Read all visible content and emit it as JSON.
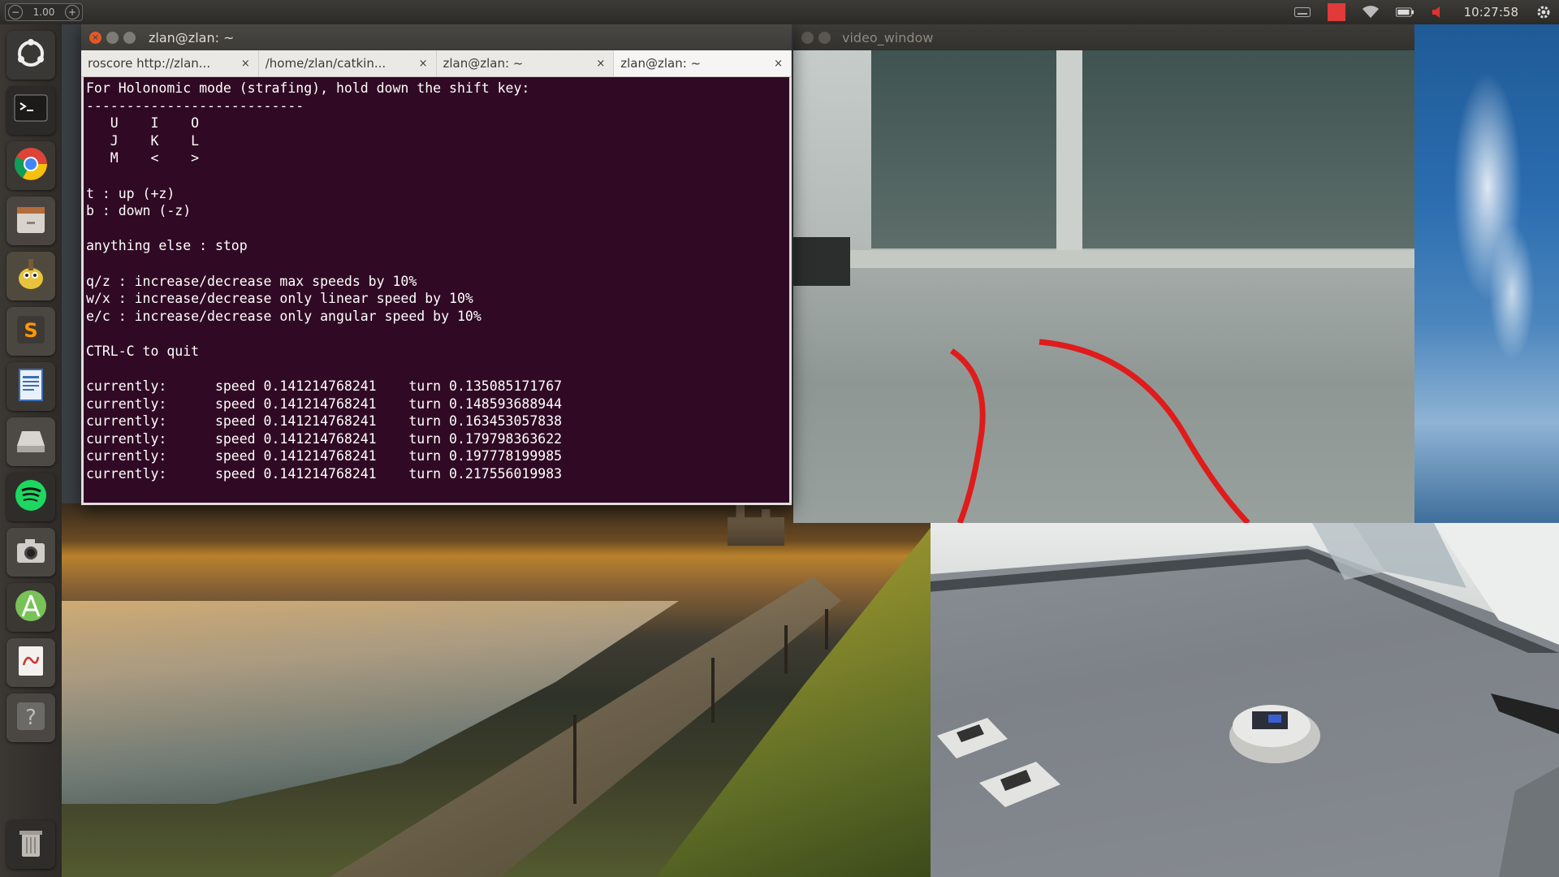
{
  "top_panel": {
    "zoom_value": "1.00",
    "clock": "10:27:58",
    "tray_icons": [
      "keyboard-icon",
      "record-indicator-icon",
      "wifi-icon",
      "battery-icon",
      "volume-icon",
      "settings-gear-icon"
    ],
    "accent_color": "#e03a3a"
  },
  "launcher": {
    "items": [
      {
        "name": "dash-home",
        "icon": "ubuntu-logo-icon"
      },
      {
        "name": "terminal",
        "icon": "terminal-icon"
      },
      {
        "name": "chrome",
        "icon": "chrome-icon"
      },
      {
        "name": "files",
        "icon": "file-cabinet-icon"
      },
      {
        "name": "gimp",
        "icon": "gimp-icon"
      },
      {
        "name": "sublime-text",
        "icon": "sublime-text-icon"
      },
      {
        "name": "writer",
        "icon": "document-icon"
      },
      {
        "name": "drive",
        "icon": "drive-icon"
      },
      {
        "name": "spotify",
        "icon": "spotify-icon"
      },
      {
        "name": "camera",
        "icon": "camera-icon"
      },
      {
        "name": "android-studio",
        "icon": "android-studio-icon"
      },
      {
        "name": "evince",
        "icon": "pdf-viewer-icon"
      },
      {
        "name": "help",
        "icon": "help-icon"
      },
      {
        "name": "trash",
        "icon": "trash-icon"
      }
    ]
  },
  "terminal": {
    "title": "zlan@zlan: ~",
    "tabs": [
      {
        "label": "roscore http://zlan...",
        "active": false
      },
      {
        "label": "/home/zlan/catkin...",
        "active": false
      },
      {
        "label": "zlan@zlan: ~",
        "active": false
      },
      {
        "label": "zlan@zlan: ~",
        "active": true
      }
    ],
    "tab_close": "×",
    "background": "#300a24",
    "lines": [
      "For Holonomic mode (strafing), hold down the shift key:",
      "---------------------------",
      "   U    I    O",
      "   J    K    L",
      "   M    <    >",
      "",
      "t : up (+z)",
      "b : down (-z)",
      "",
      "anything else : stop",
      "",
      "q/z : increase/decrease max speeds by 10%",
      "w/x : increase/decrease only linear speed by 10%",
      "e/c : increase/decrease only angular speed by 10%",
      "",
      "CTRL-C to quit",
      "",
      "currently:      speed 0.141214768241    turn 0.135085171767",
      "currently:      speed 0.141214768241    turn 0.148593688944",
      "currently:      speed 0.141214768241    turn 0.163453057838",
      "currently:      speed 0.141214768241    turn 0.179798363622",
      "currently:      speed 0.141214768241    turn 0.197778199985",
      "currently:      speed 0.141214768241    turn 0.217556019983"
    ]
  },
  "video_window": {
    "title": "video_window",
    "path_color": "#e01b1b"
  }
}
